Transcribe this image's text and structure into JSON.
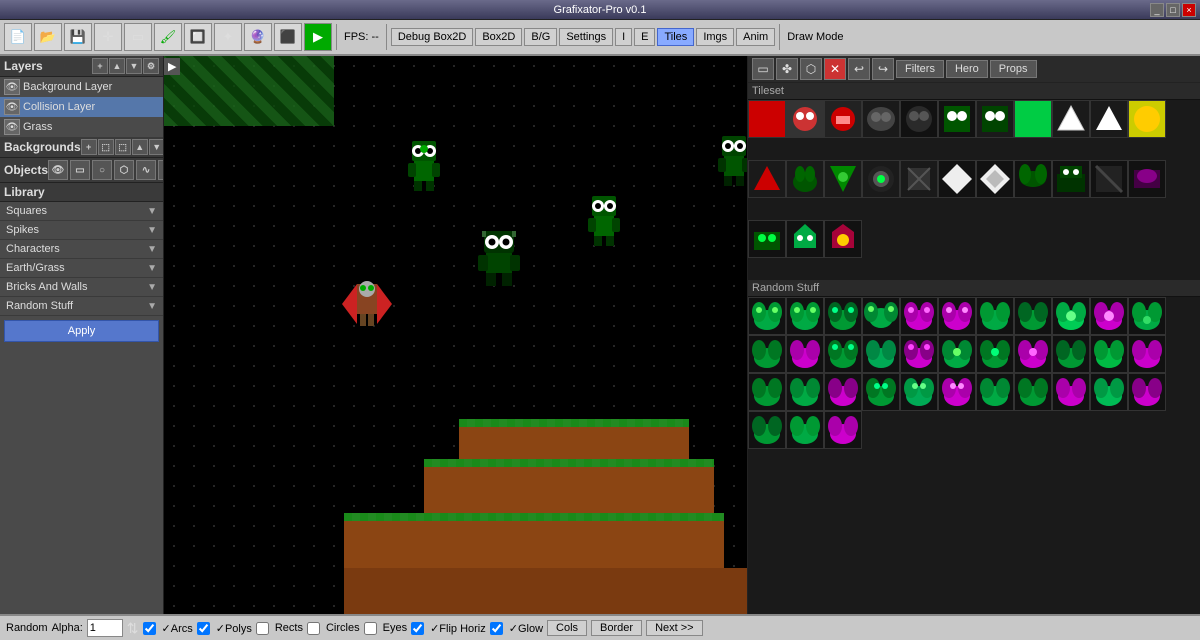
{
  "titlebar": {
    "title": "Grafixator-Pro v0.1",
    "controls": [
      "_",
      "□",
      "×"
    ]
  },
  "toolbar": {
    "fps_label": "FPS: --",
    "toggles": [
      "Debug Box2D",
      "Box2D",
      "B/G",
      "Settings",
      "I",
      "E",
      "Tiles",
      "Imgs",
      "Anim"
    ],
    "active_toggles": [
      "Tiles"
    ],
    "draw_mode_label": "Draw Mode",
    "right_tabs": [
      "Filters",
      "Hero",
      "Props"
    ]
  },
  "layers": {
    "section_label": "Layers",
    "items": [
      {
        "name": "Background Layer",
        "selected": false
      },
      {
        "name": "Collision Layer",
        "selected": true
      },
      {
        "name": "Grass",
        "selected": false
      }
    ]
  },
  "backgrounds": {
    "section_label": "Backgrounds"
  },
  "objects": {
    "section_label": "Objects"
  },
  "library": {
    "section_label": "Library",
    "items": [
      {
        "name": "Squares"
      },
      {
        "name": "Spikes"
      },
      {
        "name": "Characters"
      },
      {
        "name": "Earth/Grass"
      },
      {
        "name": "Bricks And Walls"
      },
      {
        "name": "Random Stuff"
      }
    ],
    "apply_btn": "Apply"
  },
  "right_panel": {
    "tileset_label": "Tileset",
    "random_label": "Random Stuff",
    "tabs": [
      "Filters",
      "Hero",
      "Props"
    ]
  },
  "bottombar": {
    "random_label": "Random",
    "alpha_label": "Alpha:",
    "alpha_value": "1",
    "checkboxes": [
      {
        "label": "Arcs",
        "checked": true
      },
      {
        "label": "Polys",
        "checked": true
      },
      {
        "label": "Rects",
        "checked": false
      },
      {
        "label": "Circles",
        "checked": false
      },
      {
        "label": "Eyes",
        "checked": false
      },
      {
        "label": "Flip Horiz",
        "checked": true
      },
      {
        "label": "Glow",
        "checked": true
      }
    ],
    "cols_btn": "Cols",
    "border_btn": "Border",
    "next_btn": "Next >>"
  }
}
